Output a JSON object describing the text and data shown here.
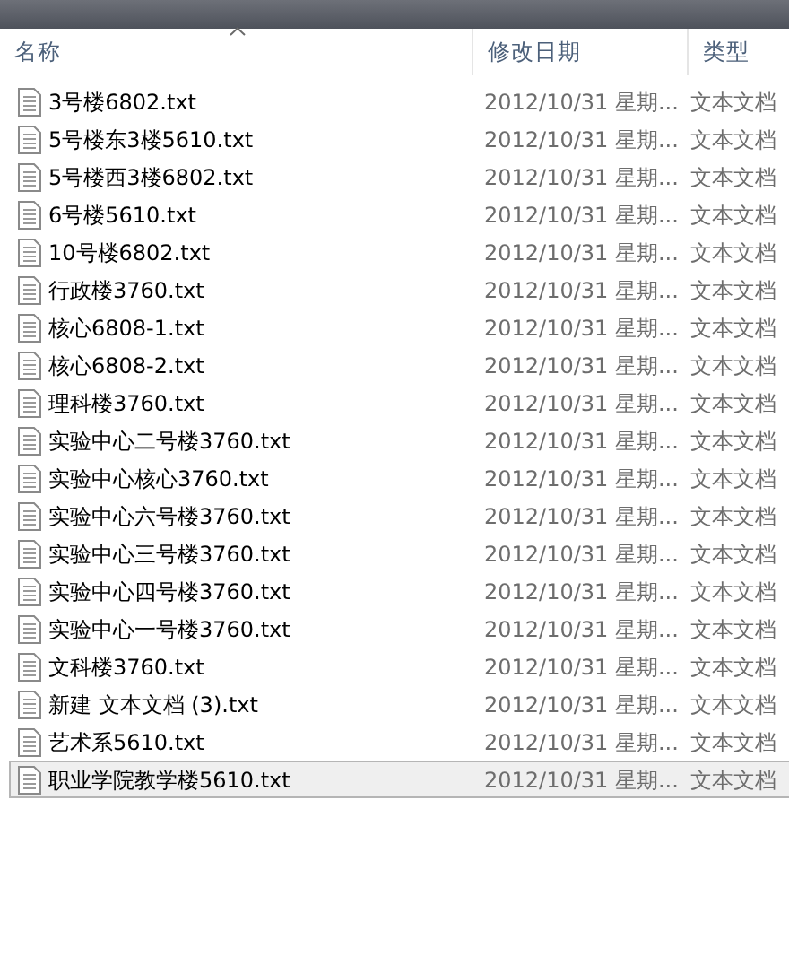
{
  "columns": [
    {
      "label": "名称",
      "sorted": true
    },
    {
      "label": "修改日期",
      "sorted": false
    },
    {
      "label": "类型",
      "sorted": false
    }
  ],
  "files": [
    {
      "name": "3号楼6802.txt",
      "date": "2012/10/31 星期...",
      "type": "文本文档",
      "selected": false
    },
    {
      "name": "5号楼东3楼5610.txt",
      "date": "2012/10/31 星期...",
      "type": "文本文档",
      "selected": false
    },
    {
      "name": "5号楼西3楼6802.txt",
      "date": "2012/10/31 星期...",
      "type": "文本文档",
      "selected": false
    },
    {
      "name": "6号楼5610.txt",
      "date": "2012/10/31 星期...",
      "type": "文本文档",
      "selected": false
    },
    {
      "name": "10号楼6802.txt",
      "date": "2012/10/31 星期...",
      "type": "文本文档",
      "selected": false
    },
    {
      "name": "行政楼3760.txt",
      "date": "2012/10/31 星期...",
      "type": "文本文档",
      "selected": false
    },
    {
      "name": "核心6808-1.txt",
      "date": "2012/10/31 星期...",
      "type": "文本文档",
      "selected": false
    },
    {
      "name": "核心6808-2.txt",
      "date": "2012/10/31 星期...",
      "type": "文本文档",
      "selected": false
    },
    {
      "name": "理科楼3760.txt",
      "date": "2012/10/31 星期...",
      "type": "文本文档",
      "selected": false
    },
    {
      "name": "实验中心二号楼3760.txt",
      "date": "2012/10/31 星期...",
      "type": "文本文档",
      "selected": false
    },
    {
      "name": "实验中心核心3760.txt",
      "date": "2012/10/31 星期...",
      "type": "文本文档",
      "selected": false
    },
    {
      "name": "实验中心六号楼3760.txt",
      "date": "2012/10/31 星期...",
      "type": "文本文档",
      "selected": false
    },
    {
      "name": "实验中心三号楼3760.txt",
      "date": "2012/10/31 星期...",
      "type": "文本文档",
      "selected": false
    },
    {
      "name": "实验中心四号楼3760.txt",
      "date": "2012/10/31 星期...",
      "type": "文本文档",
      "selected": false
    },
    {
      "name": "实验中心一号楼3760.txt",
      "date": "2012/10/31 星期...",
      "type": "文本文档",
      "selected": false
    },
    {
      "name": "文科楼3760.txt",
      "date": "2012/10/31 星期...",
      "type": "文本文档",
      "selected": false
    },
    {
      "name": "新建 文本文档 (3).txt",
      "date": "2012/10/31 星期...",
      "type": "文本文档",
      "selected": false
    },
    {
      "name": "艺术系5610.txt",
      "date": "2012/10/31 星期...",
      "type": "文本文档",
      "selected": false
    },
    {
      "name": "职业学院教学楼5610.txt",
      "date": "2012/10/31 星期...",
      "type": "文本文档",
      "selected": true
    }
  ]
}
